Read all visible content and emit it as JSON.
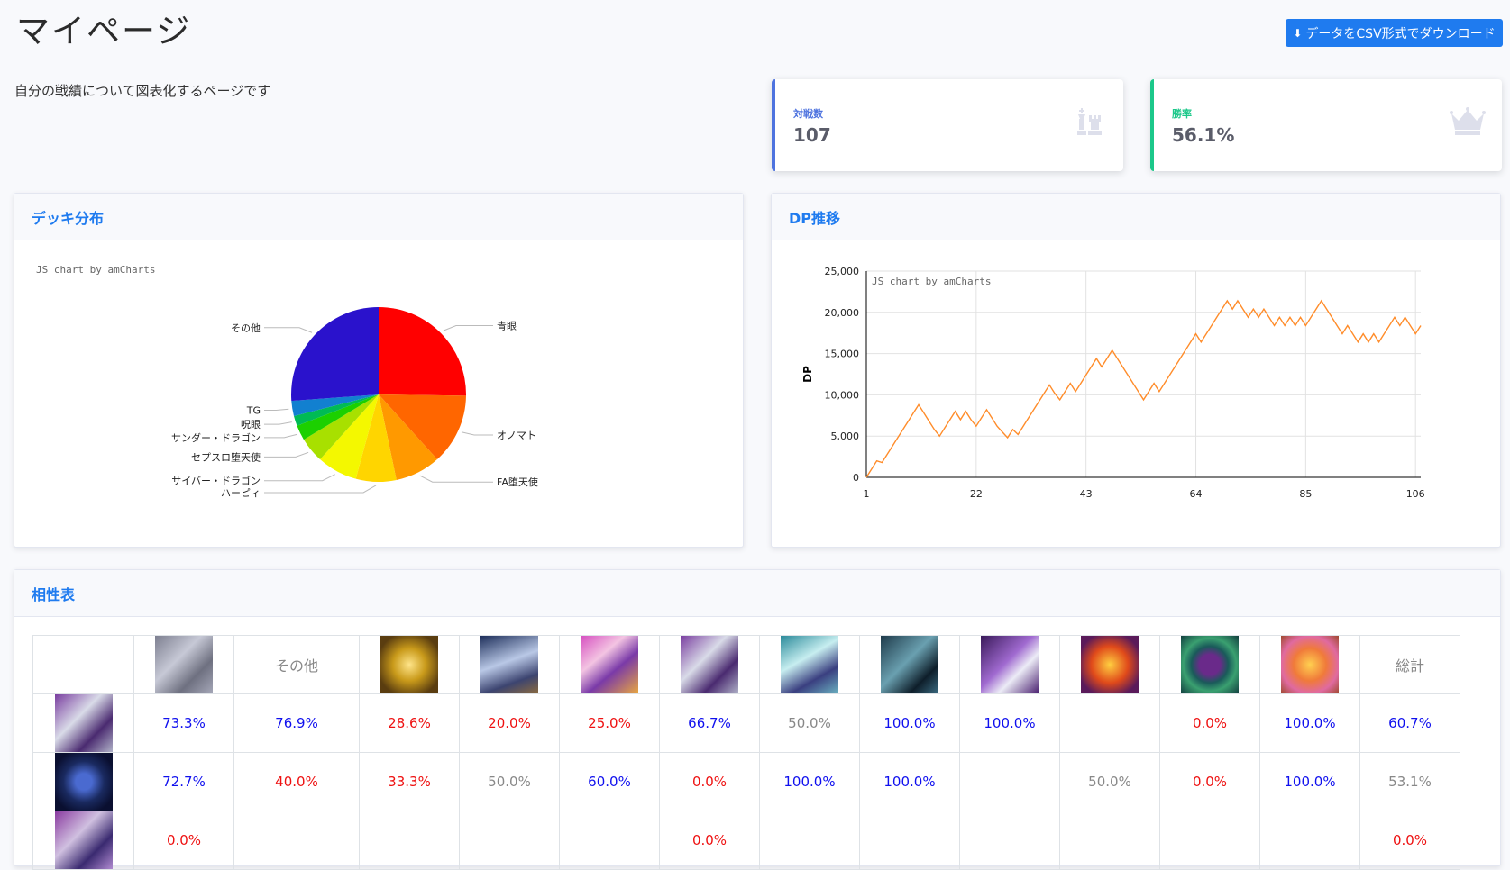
{
  "page": {
    "title": "マイページ",
    "description": "自分の戦績について図表化するページです",
    "download_label": "データをCSV形式でダウンロード"
  },
  "stats": {
    "battles": {
      "label": "対戦数",
      "value": "107",
      "icon": "chess-icon"
    },
    "winrate": {
      "label": "勝率",
      "value": "56.1%",
      "icon": "crown-icon"
    }
  },
  "deck_panel": {
    "title": "デッキ分布",
    "credit": "JS chart by amCharts"
  },
  "dp_panel": {
    "title": "DP推移",
    "credit": "JS chart by amCharts"
  },
  "matchup_panel": {
    "title": "相性表",
    "columns": [
      "",
      "img",
      "その他",
      "img",
      "img",
      "img",
      "img",
      "img",
      "img",
      "img",
      "img",
      "img",
      "img",
      "総計"
    ],
    "rows": [
      {
        "values": [
          "73.3%",
          "76.9%",
          "28.6%",
          "20.0%",
          "25.0%",
          "66.7%",
          "50.0%",
          "100.0%",
          "100.0%",
          "",
          "0.0%",
          "100.0%",
          "60.7%"
        ],
        "colors": [
          "blue",
          "blue",
          "red",
          "red",
          "red",
          "blue",
          "gray",
          "blue",
          "blue",
          "",
          "red",
          "blue",
          "blue"
        ]
      },
      {
        "values": [
          "72.7%",
          "40.0%",
          "33.3%",
          "50.0%",
          "60.0%",
          "0.0%",
          "100.0%",
          "100.0%",
          "",
          "50.0%",
          "0.0%",
          "100.0%",
          "53.1%"
        ],
        "colors": [
          "blue",
          "red",
          "red",
          "gray",
          "blue",
          "red",
          "blue",
          "blue",
          "",
          "gray",
          "red",
          "blue",
          "gray"
        ]
      },
      {
        "values": [
          "0.0%",
          "",
          "",
          "",
          "",
          "0.0%",
          "",
          "",
          "",
          "",
          "",
          "",
          "0.0%"
        ],
        "colors": [
          "red",
          "",
          "",
          "",
          "",
          "red",
          "",
          "",
          "",
          "",
          "",
          "",
          "red"
        ]
      }
    ]
  },
  "chart_data": [
    {
      "type": "pie",
      "title": "",
      "categories": [
        "青眼",
        "オノマト",
        "FA堕天使",
        "ハーピィ",
        "サイバー・ドラゴン",
        "セプスロ堕天使",
        "サンダー・ドラゴン",
        "呪眼",
        "TG",
        "その他"
      ],
      "values": [
        27,
        14,
        9,
        8,
        8,
        5,
        3,
        2,
        3,
        28
      ],
      "colors": [
        "#ff0000",
        "#ff6600",
        "#ff9900",
        "#ffd500",
        "#f4f800",
        "#a8e000",
        "#1cd000",
        "#00bb55",
        "#1280d0",
        "#2a12cc"
      ]
    },
    {
      "type": "line",
      "title": "",
      "ylabel": "DP",
      "xlabel": "",
      "x_ticks": [
        "1",
        "22",
        "43",
        "64",
        "85",
        "106"
      ],
      "y_ticks": [
        "0",
        "5,000",
        "10,000",
        "15,000",
        "20,000",
        "25,000"
      ],
      "ylim": [
        0,
        25000
      ],
      "xlim": [
        1,
        107
      ],
      "color": "#ff8c2a",
      "values": [
        0,
        1000,
        2000,
        1800,
        2800,
        3800,
        4800,
        5800,
        6800,
        7800,
        8800,
        7800,
        6800,
        5800,
        5000,
        6000,
        7000,
        8000,
        7000,
        8000,
        7000,
        6200,
        7200,
        8200,
        7200,
        6200,
        5500,
        4800,
        5800,
        5200,
        6200,
        7200,
        8200,
        9200,
        10200,
        11200,
        10200,
        9400,
        10400,
        11400,
        10400,
        11400,
        12400,
        13400,
        14400,
        13400,
        14400,
        15400,
        14400,
        13400,
        12400,
        11400,
        10400,
        9400,
        10400,
        11400,
        10400,
        11400,
        12400,
        13400,
        14400,
        15400,
        16400,
        17400,
        16400,
        17400,
        18400,
        19400,
        20400,
        21400,
        20400,
        21400,
        20400,
        19400,
        20400,
        19400,
        20400,
        19400,
        18400,
        19400,
        18400,
        19400,
        18400,
        19400,
        18400,
        19400,
        20400,
        21400,
        20400,
        19400,
        18400,
        17400,
        18400,
        17400,
        16400,
        17400,
        16400,
        17400,
        16400,
        17400,
        18400,
        19400,
        18400,
        19400,
        18400,
        17400,
        18400
      ]
    }
  ]
}
